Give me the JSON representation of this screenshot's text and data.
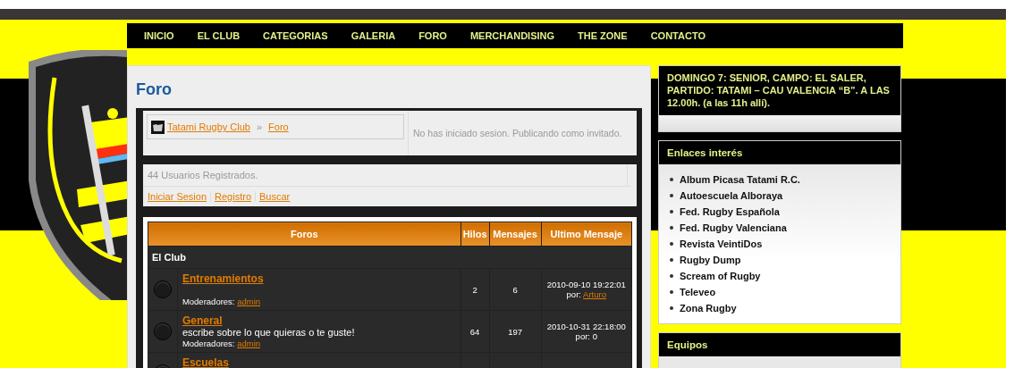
{
  "nav": [
    {
      "label": "INICIO"
    },
    {
      "label": "EL CLUB"
    },
    {
      "label": "CATEGORIAS"
    },
    {
      "label": "GALERIA"
    },
    {
      "label": "FORO"
    },
    {
      "label": "MERCHANDISING"
    },
    {
      "label": "THE ZONE"
    },
    {
      "label": "CONTACTO"
    }
  ],
  "forum": {
    "title": "Foro",
    "breadcrumb": {
      "items": [
        "Tatami Rugby Club",
        "Foro"
      ],
      "separator": "»"
    },
    "login_status": "No has iniciado sesion. Publicando como invitado.",
    "users": "44 Usuarios Registrados.",
    "links": [
      "Iniciar Sesion",
      "Registro",
      "Buscar"
    ],
    "table": {
      "columns": [
        "Foros",
        "Hilos",
        "Mensajes",
        "Ultimo Mensaje"
      ],
      "category": "El Club",
      "rows": [
        {
          "name": "Entrenamientos",
          "moderators_label": "Moderadores:",
          "moderator": "admin",
          "threads": "2",
          "messages": "6",
          "last_date": "2010-09-10 19:22:01",
          "by_label": "por:",
          "by": "Arturo",
          "by_linked": true
        },
        {
          "name": "General",
          "description": "escribe sobre lo que quieras o te guste!",
          "moderators_label": "Moderadores:",
          "moderator": "admin",
          "threads": "64",
          "messages": "197",
          "last_date": "2010-10-31 22:18:00",
          "by_label": "por:",
          "by": "0",
          "by_linked": false
        },
        {
          "name": "Escuelas"
        }
      ]
    }
  },
  "sidebar": {
    "notice": "DOMINGO 7: SENIOR, CAMPO: EL SALER, PARTIDO: TATAMI – CAU VALENCIA “B”. A LAS 12.00h. (a las 11h allí).",
    "links_box": {
      "title": "Enlaces interés",
      "items": [
        "Album Picasa Tatami R.C.",
        "Autoescuela Alboraya",
        "Fed. Rugby Española",
        "Fed. Rugby Valenciana",
        "Revista VeintiDos",
        "Rugby Dump",
        "Scream of Rugby",
        "Televeo",
        "Zona Rugby"
      ]
    },
    "teams_box": {
      "title": "Equipos"
    }
  }
}
